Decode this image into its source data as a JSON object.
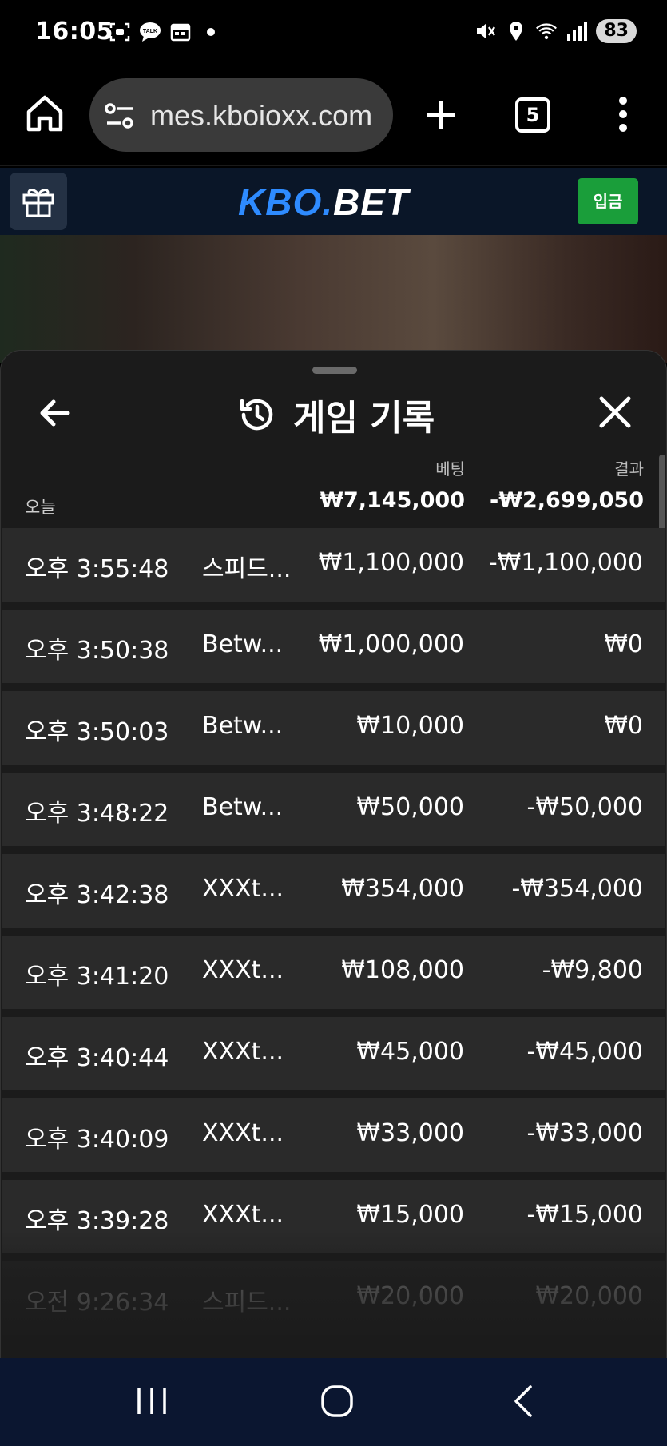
{
  "status_bar": {
    "time": "16:05",
    "battery": "83",
    "left_icons": [
      "screenshot-icon",
      "talk-icon",
      "calendar-icon",
      "dot-icon"
    ],
    "right_icons": [
      "mute-icon",
      "location-icon",
      "wifi-icon",
      "signal-icon"
    ]
  },
  "browser": {
    "url": "mes.kboioxx.com",
    "tab_count": "5"
  },
  "site": {
    "logo_kbo": "KBO",
    "logo_dot": ".",
    "logo_bet": "BET",
    "deposit_label": "입금"
  },
  "sheet": {
    "title": "게임 기록",
    "col_bet": "베팅",
    "col_result": "결과",
    "day_label": "오늘",
    "total_bet": "₩7,145,000",
    "total_result": "-₩2,699,050",
    "rows": [
      {
        "time": "오후 3:55:48",
        "game": "스피드...",
        "bet": "₩1,100,000",
        "result": "-₩1,100,000"
      },
      {
        "time": "오후 3:50:38",
        "game": "Betw...",
        "bet": "₩1,000,000",
        "result": "₩0"
      },
      {
        "time": "오후 3:50:03",
        "game": "Betw...",
        "bet": "₩10,000",
        "result": "₩0"
      },
      {
        "time": "오후 3:48:22",
        "game": "Betw...",
        "bet": "₩50,000",
        "result": "-₩50,000"
      },
      {
        "time": "오후 3:42:38",
        "game": "XXXt...",
        "bet": "₩354,000",
        "result": "-₩354,000"
      },
      {
        "time": "오후 3:41:20",
        "game": "XXXt...",
        "bet": "₩108,000",
        "result": "-₩9,800"
      },
      {
        "time": "오후 3:40:44",
        "game": "XXXt...",
        "bet": "₩45,000",
        "result": "-₩45,000"
      },
      {
        "time": "오후 3:40:09",
        "game": "XXXt...",
        "bet": "₩33,000",
        "result": "-₩33,000"
      },
      {
        "time": "오후 3:39:28",
        "game": "XXXt...",
        "bet": "₩15,000",
        "result": "-₩15,000"
      },
      {
        "time": "오전 9:26:34",
        "game": "스피드...",
        "bet": "₩20,000",
        "result": "₩20,000"
      }
    ]
  },
  "colors": {
    "logo_blue": "#2e8bff",
    "deposit_green": "#1a9e3a",
    "header_bg": "#0a1628",
    "sheet_bg": "#1b1b1b",
    "row_bg": "#2a2a2a"
  }
}
